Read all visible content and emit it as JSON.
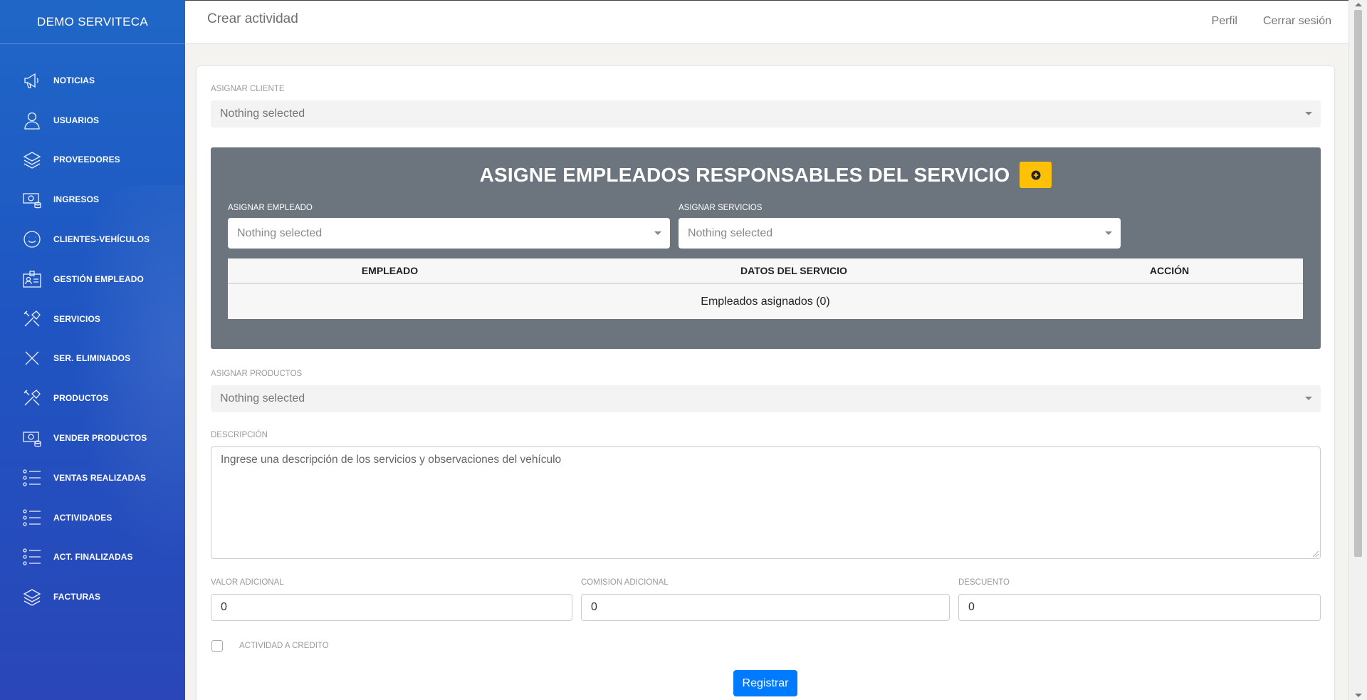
{
  "sidebar": {
    "brand": "DEMO SERVITECA",
    "items": [
      {
        "label": "NOTICIAS",
        "icon": "megaphone-icon"
      },
      {
        "label": "USUARIOS",
        "icon": "user-icon"
      },
      {
        "label": "PROVEEDORES",
        "icon": "layers-icon"
      },
      {
        "label": "INGRESOS",
        "icon": "money-icon"
      },
      {
        "label": "CLIENTES-VEHÍCULOS",
        "icon": "smile-icon"
      },
      {
        "label": "GESTIÓN EMPLEADO",
        "icon": "badge-icon"
      },
      {
        "label": "SERVICIOS",
        "icon": "tools-icon"
      },
      {
        "label": "SER. ELIMINADOS",
        "icon": "close-icon"
      },
      {
        "label": "PRODUCTOS",
        "icon": "tools-icon"
      },
      {
        "label": "VENDER PRODUCTOS",
        "icon": "money-icon"
      },
      {
        "label": "VENTAS REALIZADAS",
        "icon": "list-icon"
      },
      {
        "label": "ACTIVIDADES",
        "icon": "list-icon"
      },
      {
        "label": "ACT. FINALIZADAS",
        "icon": "list-icon"
      },
      {
        "label": "FACTURAS",
        "icon": "layers-icon"
      }
    ]
  },
  "header": {
    "title": "Crear actividad",
    "profile": "Perfil",
    "logout": "Cerrar sesión"
  },
  "form": {
    "cliente_label": "ASIGNAR CLIENTE",
    "cliente_value": "Nothing selected",
    "panel_title": "ASIGNE EMPLEADOS RESPONSABLES DEL SERVICIO",
    "empleado_label": "ASIGNAR EMPLEADO",
    "empleado_value": "Nothing selected",
    "servicios_label": "ASIGNAR SERVICIOS",
    "servicios_value": "Nothing selected",
    "table_headers": [
      "EMPLEADO",
      "DATOS DEL SERVICIO",
      "ACCIÓN"
    ],
    "table_empty": "Empleados asignados (0)",
    "productos_label": "ASIGNAR PRODUCTOS",
    "productos_value": "Nothing selected",
    "descripcion_label": "DESCRIPCIÓN",
    "descripcion_placeholder": "Ingrese una descripción de los servicios y observaciones del vehículo",
    "valor_label": "VALOR ADICIONAL",
    "valor_value": "0",
    "comision_label": "COMISION ADICIONAL",
    "comision_value": "0",
    "descuento_label": "DESCUENTO",
    "descuento_value": "0",
    "credito_label": "ACTIVIDAD A CREDITO",
    "submit_label": "Registrar"
  },
  "colors": {
    "sidebar": "#1f5fc4",
    "panel": "#6c757d",
    "add_button": "#ffc107",
    "submit_button": "#007bff"
  }
}
